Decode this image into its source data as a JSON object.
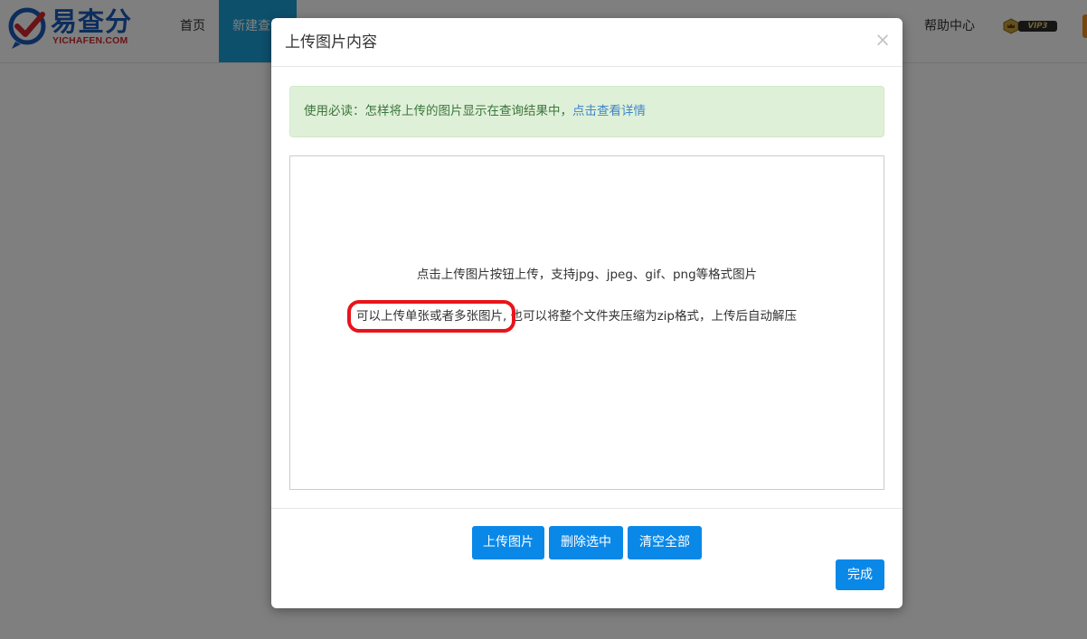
{
  "navbar": {
    "logo_text": "易查分",
    "logo_subtext": "YICHAFEN.COM",
    "items": [
      {
        "label": "首页"
      },
      {
        "label": "新建查询"
      },
      {
        "label": "帮助中心"
      }
    ],
    "vip_label": "VIP3"
  },
  "modal": {
    "title": "上传图片内容",
    "close_symbol": "×",
    "notice": {
      "text": "使用必读：怎样将上传的图片显示在查询结果中，",
      "link": "点击查看详情"
    },
    "dropzone": {
      "line1": "点击上传图片按钮上传，支持jpg、jpeg、gif、png等格式图片",
      "line2_highlight": "可以上传单张或者多张图片,",
      "line2_rest": " 也可以将整个文件夹压缩为zip格式，上传后自动解压"
    },
    "buttons": {
      "upload": "上传图片",
      "delete": "删除选中",
      "clear": "清空全部",
      "done": "完成"
    }
  },
  "colors": {
    "primary_button": "#0a88e8",
    "nav_active": "#1aa1d9",
    "notice_bg": "#dff0d8",
    "notice_text": "#3c763d",
    "highlight_box": "#e8141b"
  }
}
